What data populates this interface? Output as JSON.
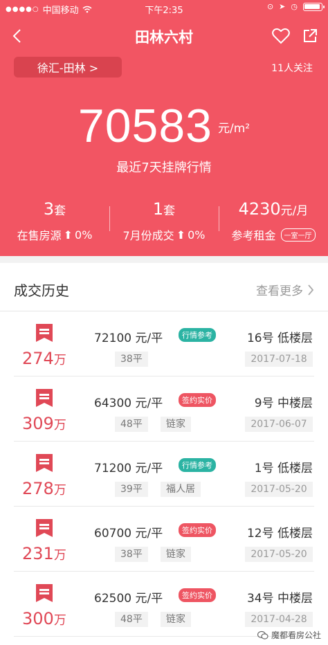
{
  "status": {
    "carrier": "中国移动",
    "time": "下午2:35"
  },
  "nav": {
    "title": "田林六村"
  },
  "district": "徐汇-田林 >",
  "followers": "11人关注",
  "price": {
    "value": "70583",
    "unit": "元/m²",
    "subtitle": "最近7天挂牌行情"
  },
  "stats": [
    {
      "value": "3",
      "unit": "套",
      "label": "在售房源",
      "change": "0%"
    },
    {
      "value": "1",
      "unit": "套",
      "label": "7月份成交",
      "change": "0%"
    },
    {
      "value": "4230",
      "unit": "元/月",
      "label": "参考租金",
      "tag": "一室一厅"
    }
  ],
  "history": {
    "title": "成交历史",
    "more": "查看更多",
    "rows": [
      {
        "total": "274",
        "total_unit": "万",
        "unit_price": "72100 元/平",
        "badge": "行情参考",
        "area": "38平",
        "agency": "",
        "floor": "16号 低楼层",
        "date": "2017-07-18"
      },
      {
        "total": "309",
        "total_unit": "万",
        "unit_price": "64300 元/平",
        "badge": "签约实价",
        "area": "48平",
        "agency": "链家",
        "floor": "9号 中楼层",
        "date": "2017-06-07"
      },
      {
        "total": "278",
        "total_unit": "万",
        "unit_price": "71200 元/平",
        "badge": "行情参考",
        "area": "39平",
        "agency": "福人居",
        "floor": "1号 低楼层",
        "date": "2017-05-20"
      },
      {
        "total": "231",
        "total_unit": "万",
        "unit_price": "60700 元/平",
        "badge": "签约实价",
        "area": "38平",
        "agency": "链家",
        "floor": "12号 低楼层",
        "date": "2017-05-20"
      },
      {
        "total": "300",
        "total_unit": "万",
        "unit_price": "62500 元/平",
        "badge": "签约实价",
        "area": "48平",
        "agency": "链家",
        "floor": "34号 中楼层",
        "date": "2017-04-28"
      }
    ]
  },
  "watermark": "魔都看房公社",
  "colors": {
    "hero": "#f25563",
    "badge_reference": "#2bb3a3",
    "badge_signed": "#ee5562",
    "total": "#e04856"
  }
}
